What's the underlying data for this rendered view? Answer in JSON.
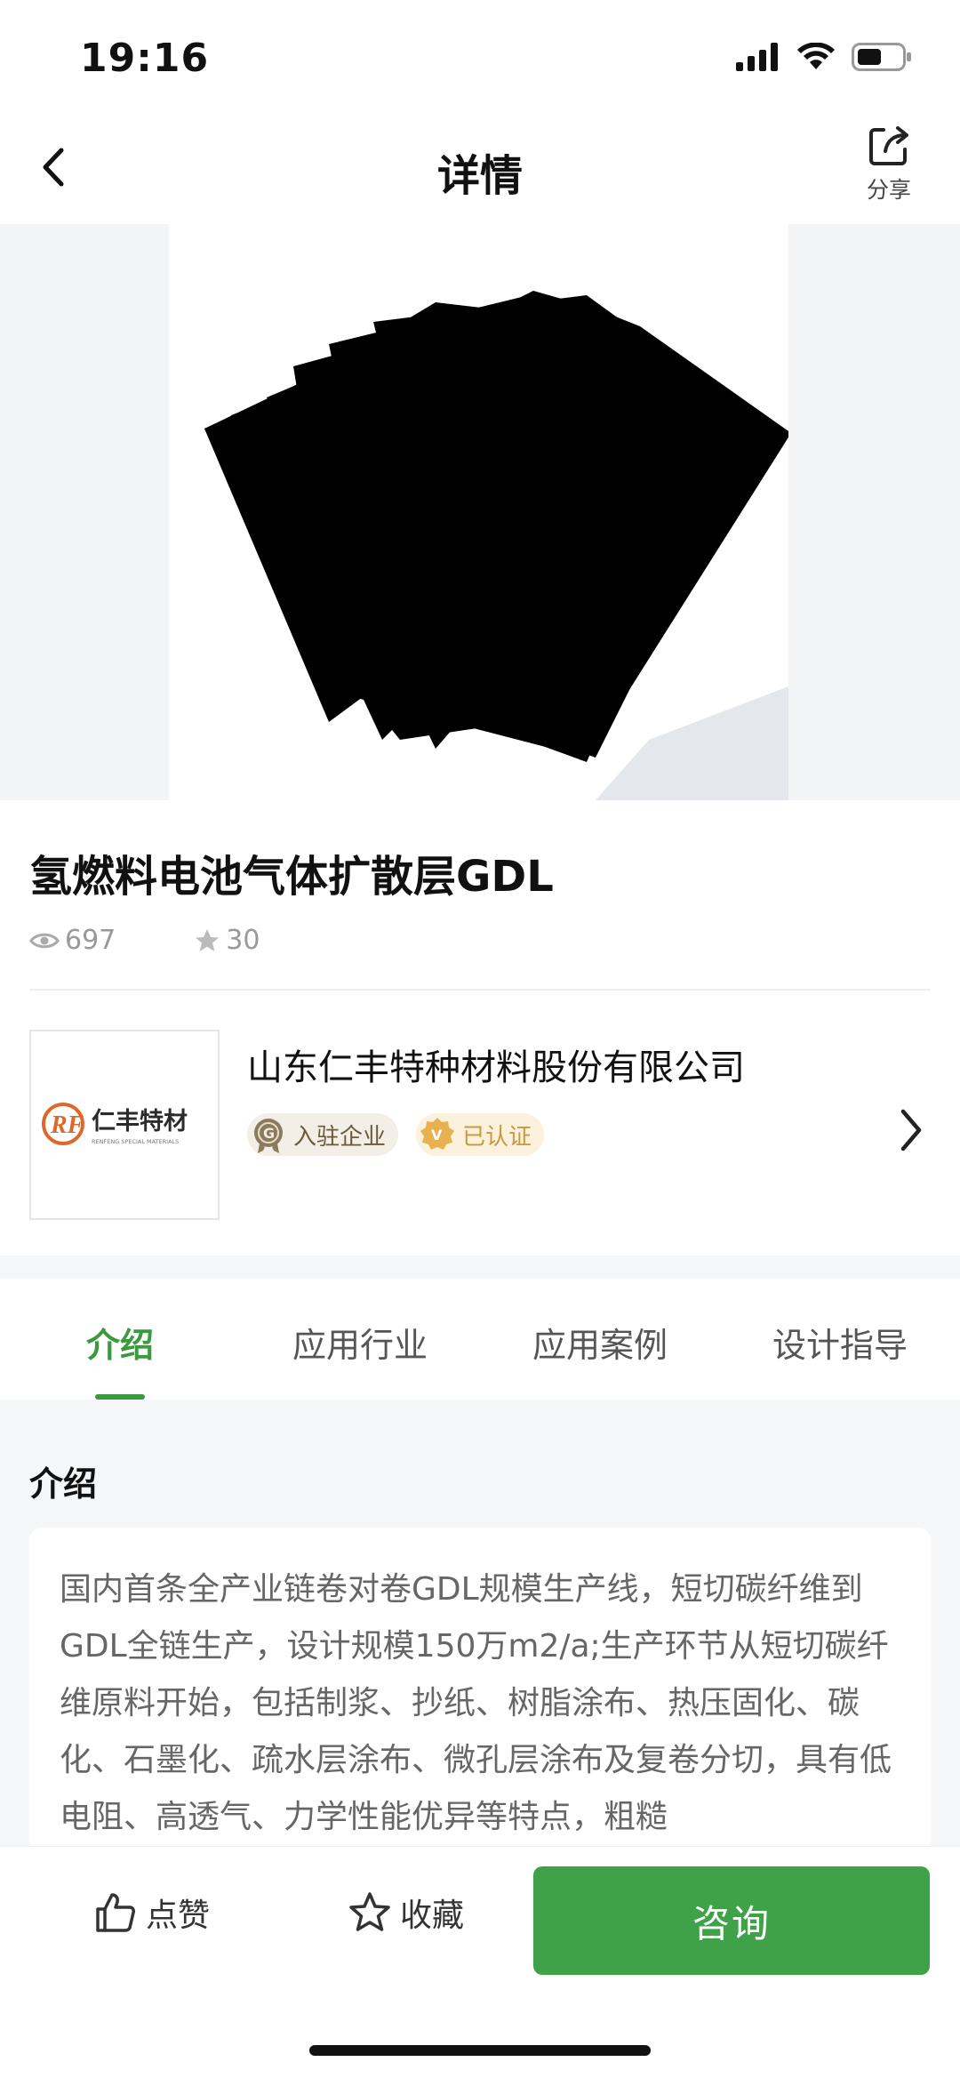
{
  "status_bar": {
    "time": "19:16"
  },
  "nav": {
    "title": "详情",
    "share_label": "分享"
  },
  "product": {
    "title": "氢燃料电池气体扩散层GDL",
    "views": "697",
    "favorites": "30"
  },
  "company": {
    "name": "山东仁丰特种材料股份有限公司",
    "logo_text": "仁丰特材",
    "logo_subtext": "RENFENG SPECIAL MATERIALS",
    "logo_mark": "RF",
    "badge_settled": "入驻企业",
    "badge_verified": "已认证"
  },
  "tabs": [
    {
      "label": "介绍",
      "active": true
    },
    {
      "label": "应用行业",
      "active": false
    },
    {
      "label": "应用案例",
      "active": false
    },
    {
      "label": "设计指导",
      "active": false
    }
  ],
  "intro": {
    "heading": "介绍",
    "text": "国内首条全产业链卷对卷GDL规模生产线，短切碳纤维到GDL全链生产，设计规模150万m2/a;生产环节从短切碳纤维原料开始，包括制浆、抄纸、树脂涂布、热压固化、碳化、石墨化、疏水层涂布、微孔层涂布及复卷分切，具有低电阻、高透气、力学性能优异等特点，粗糙"
  },
  "bottom_bar": {
    "like_label": "点赞",
    "favorite_label": "收藏",
    "consult_label": "咨询"
  },
  "colors": {
    "accent": "#3a9a3f",
    "consult_button": "#3fa248",
    "logo_orange": "#e0672a"
  }
}
